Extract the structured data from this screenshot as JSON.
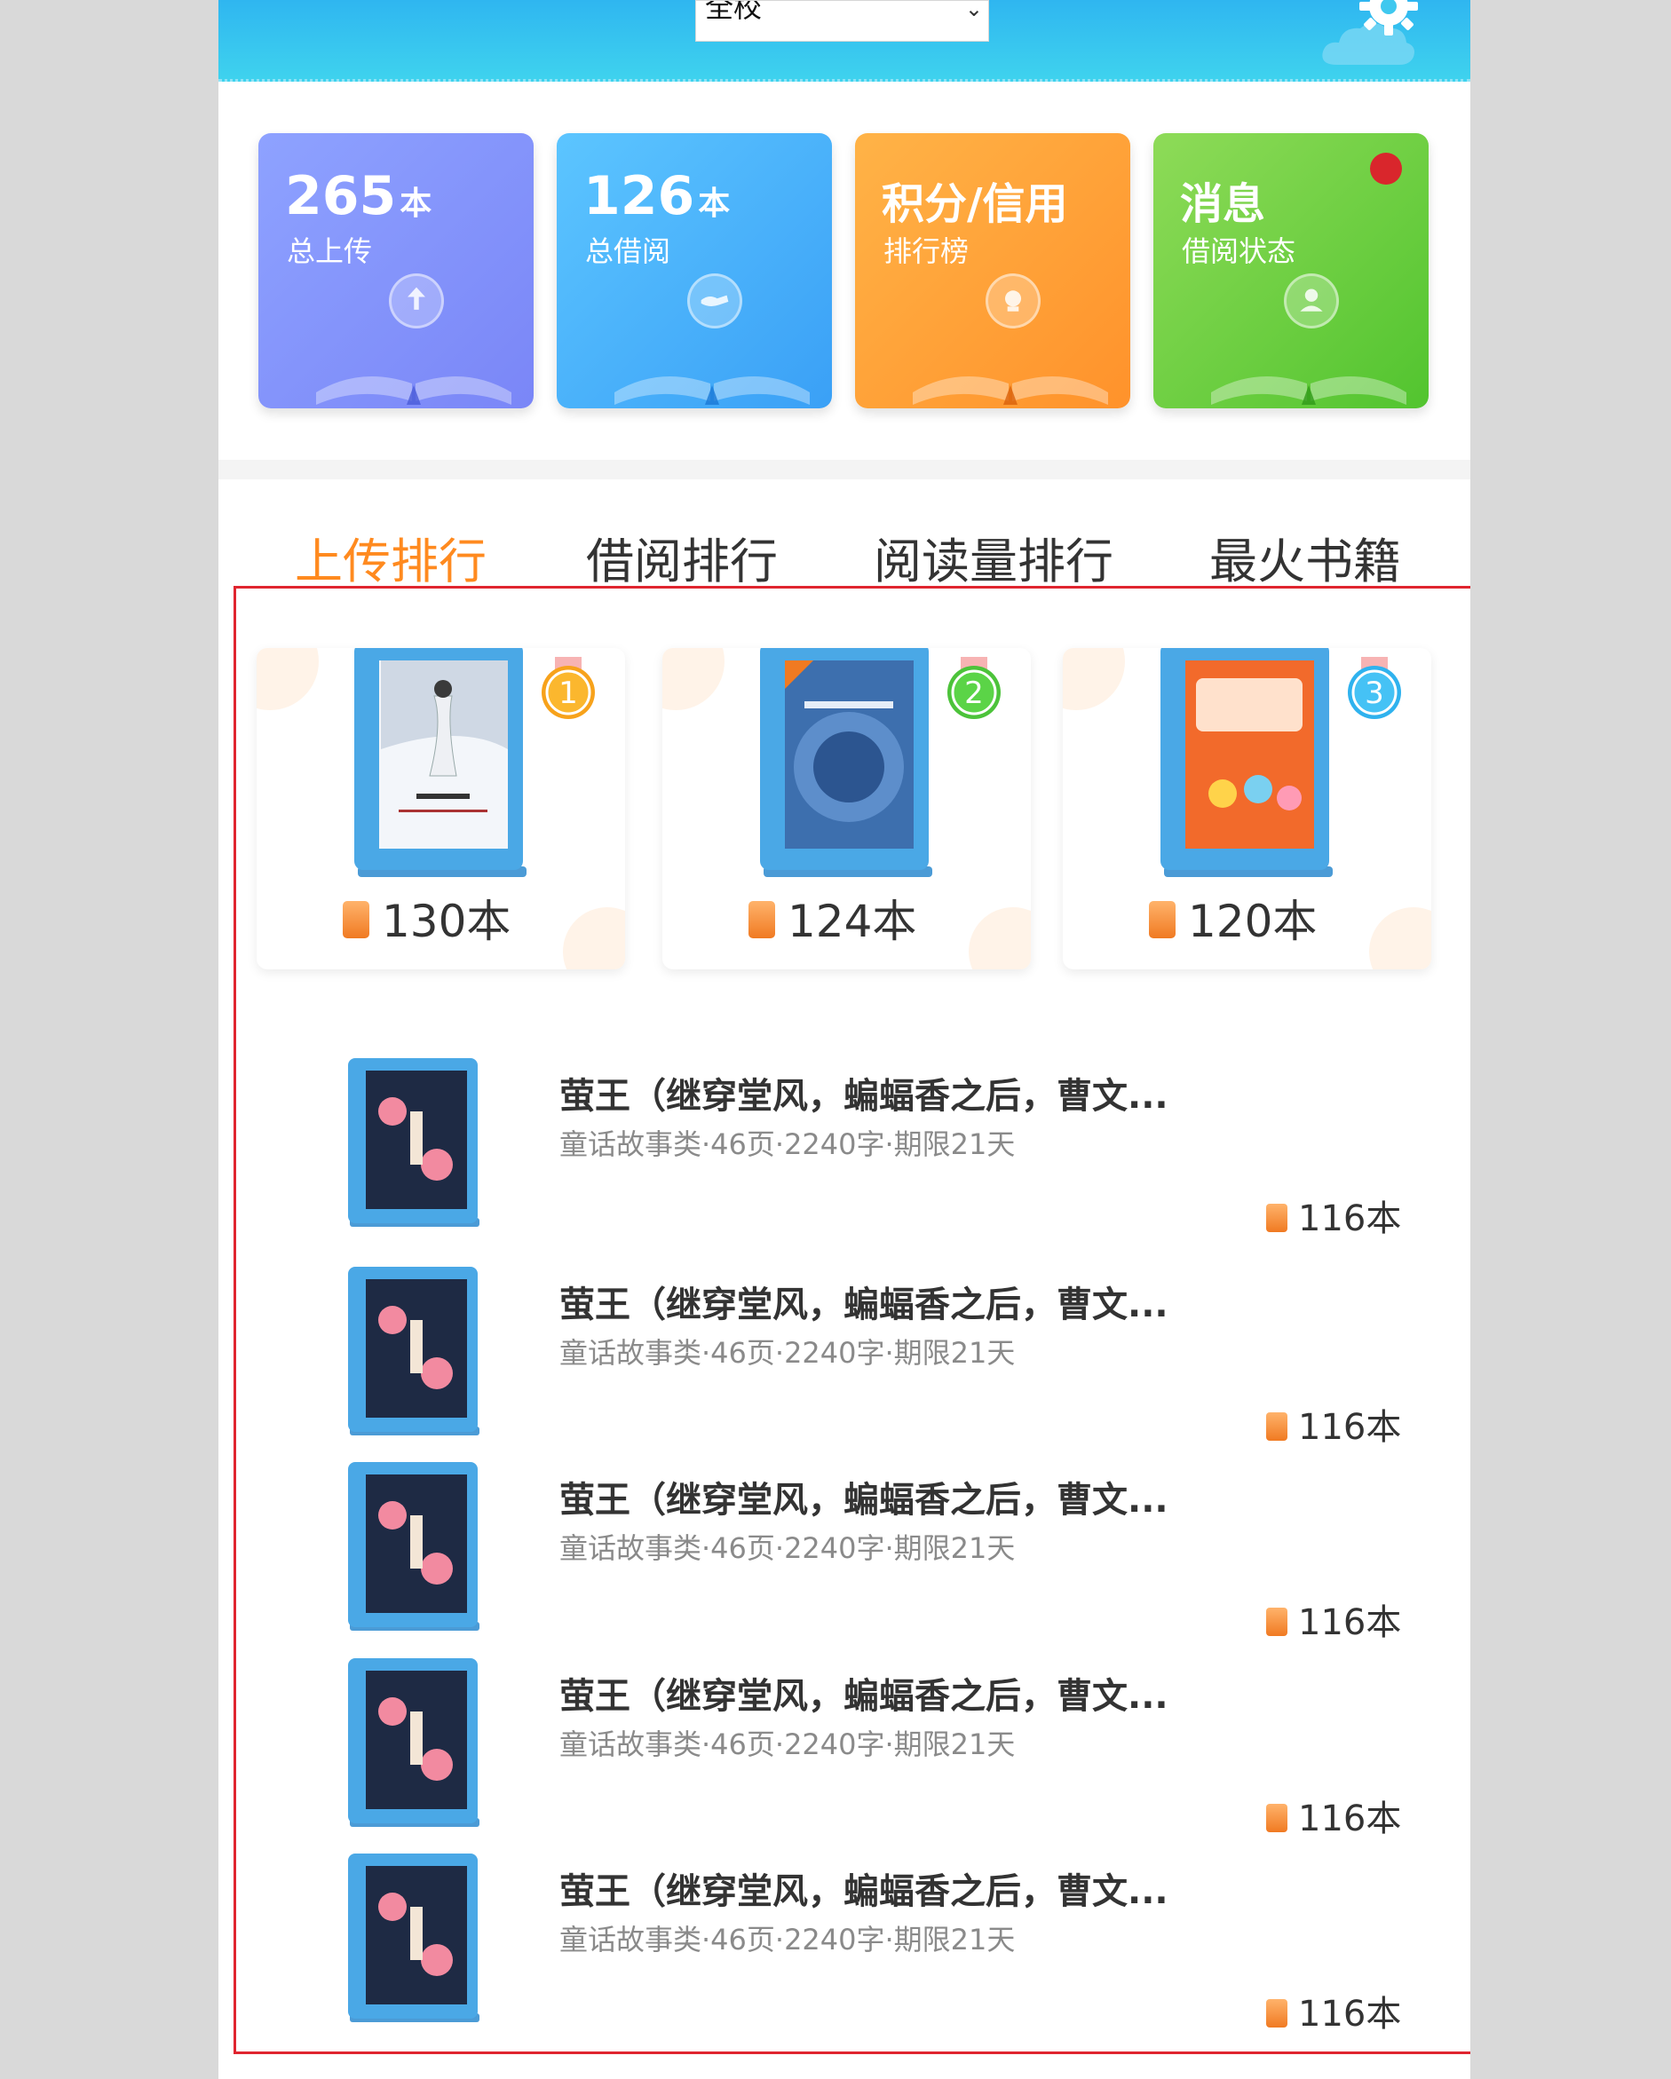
{
  "header": {
    "school_select": {
      "value": "全校"
    }
  },
  "stats": [
    {
      "big": "265",
      "unit": "本",
      "sub": "总上传",
      "icon": "upload-icon",
      "color": "#8290fa"
    },
    {
      "big": "126",
      "unit": "本",
      "sub": "总借阅",
      "icon": "handshake-icon",
      "color": "#47aef8"
    },
    {
      "big": "积分/信用",
      "unit": "",
      "sub": "排行榜",
      "icon": "trophy-icon",
      "color": "#ffa03a"
    },
    {
      "big": "消息",
      "unit": "",
      "sub": "借阅状态",
      "icon": "user-icon",
      "color": "#6fd044",
      "has_unread": true
    }
  ],
  "tabs": [
    {
      "label": "上传排行",
      "active": true
    },
    {
      "label": "借阅排行",
      "active": false
    },
    {
      "label": "阅读量排行",
      "active": false
    },
    {
      "label": "最火书籍",
      "active": false
    }
  ],
  "top3": [
    {
      "rank": "1",
      "count": "130本",
      "medal_color": "#f7a21b"
    },
    {
      "rank": "2",
      "count": "124本",
      "medal_color": "#4cc33a"
    },
    {
      "rank": "3",
      "count": "120本",
      "medal_color": "#2fb2ee"
    }
  ],
  "list": [
    {
      "title": "萤王（继穿堂风，蝙蝠香之后，曹文...",
      "meta": "童话故事类·46页·2240字·期限21天",
      "count": "116本"
    },
    {
      "title": "萤王（继穿堂风，蝙蝠香之后，曹文...",
      "meta": "童话故事类·46页·2240字·期限21天",
      "count": "116本"
    },
    {
      "title": "萤王（继穿堂风，蝙蝠香之后，曹文...",
      "meta": "童话故事类·46页·2240字·期限21天",
      "count": "116本"
    },
    {
      "title": "萤王（继穿堂风，蝙蝠香之后，曹文...",
      "meta": "童话故事类·46页·2240字·期限21天",
      "count": "116本"
    },
    {
      "title": "萤王（继穿堂风，蝙蝠香之后，曹文...",
      "meta": "童话故事类·46页·2240字·期限21天",
      "count": "116本"
    }
  ],
  "colors": {
    "accent": "#ff8a1f",
    "header": "#3fc8ef",
    "selection_frame": "#e0252f"
  }
}
